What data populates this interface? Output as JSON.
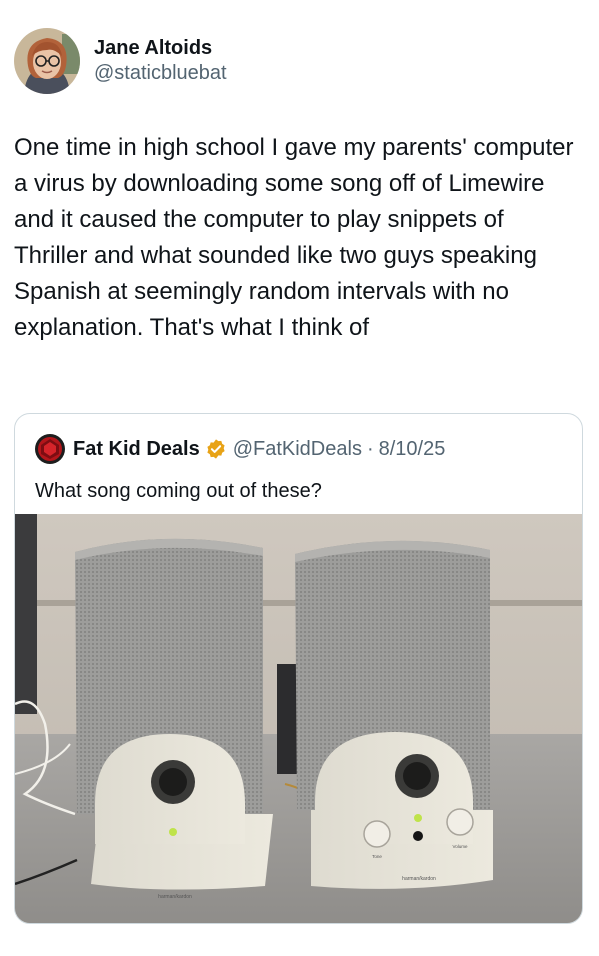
{
  "author": {
    "display_name": "Jane Altoids",
    "handle": "@staticbluebat",
    "avatar_icon": "user-avatar"
  },
  "tweet": {
    "text": "One time in high school I gave my parents' computer a virus by downloading some song off of Limewire and it caused the computer to play snippets of Thriller and what sounded like two guys speaking Spanish at seemingly random intervals with no explanation. That's what I think of"
  },
  "quote": {
    "display_name": "Fat Kid Deals",
    "verified": true,
    "verified_color": "#e8a317",
    "handle": "@FatKidDeals",
    "separator": "·",
    "date": "8/10/25",
    "text": "What song coming out of these?",
    "media": {
      "icon": "speakers-photo",
      "left_speaker_brand": "harman/kardon",
      "right_speaker_brand": "harman/kardon",
      "knob_labels": [
        "Tone",
        "Volume"
      ]
    }
  },
  "colors": {
    "text_primary": "#0f1419",
    "text_secondary": "#536471",
    "border": "#cfd9de"
  }
}
